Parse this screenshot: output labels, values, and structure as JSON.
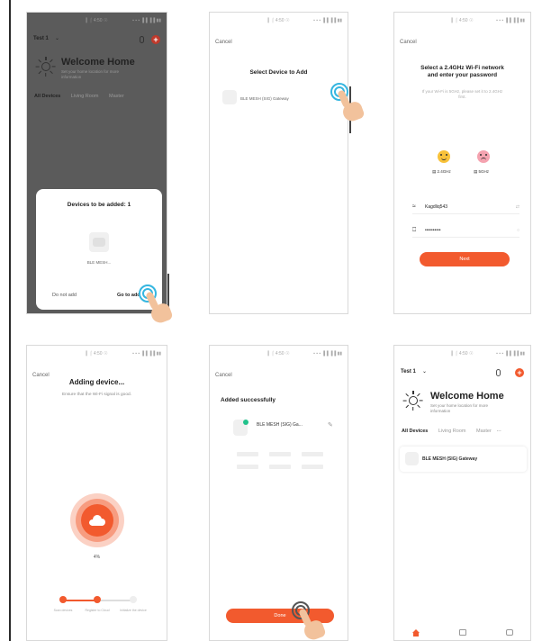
{
  "status": {
    "carrier": "▐◔ 4:58 ○",
    "center": "▎⌠ 4:50 ☉",
    "right": "▪ ▪ ▪ ▐▐ ▐▐ ▮▮"
  },
  "common": {
    "cancel": "Cancel"
  },
  "screen1": {
    "home_name": "Test 1",
    "welcome": "Welcome Home",
    "welcome_sub": "Set your home location for more information",
    "tabs": [
      "All Devices",
      "Living Room",
      "Master"
    ],
    "sheet_title": "Devices to be added: 1",
    "device_name": "BLE MESH...",
    "btn_cancel": "Do not add",
    "btn_go": "Go to add"
  },
  "screen2": {
    "title": "Select Device to Add",
    "device_item": "BLE MESH (SIG) Gateway"
  },
  "screen3": {
    "title_line1": "Select a 2.4GHz Wi-Fi network",
    "title_line2": "and enter your password",
    "subtitle": "If your Wi-Fi is 5GHz, please set it to 2.4GHz first.",
    "band_24": "2.4GHz",
    "band_5": "5GHz",
    "ssid": "Kagdliq543",
    "password": "••••••••••",
    "next": "Next"
  },
  "screen4": {
    "title": "Adding device...",
    "subtitle": "Ensure that the Wi-Fi signal is good.",
    "percent": "4%",
    "steps": [
      "Scan devices",
      "Register to Cloud",
      "Initialize the device"
    ]
  },
  "screen5": {
    "title": "Added successfully",
    "device_name": "BLE MESH (SIG) Ga...",
    "done": "Done"
  },
  "screen6": {
    "home_name": "Test 1",
    "welcome": "Welcome Home",
    "welcome_sub": "Set your home location for more information",
    "tabs": [
      "All Devices",
      "Living Room",
      "Master"
    ],
    "more": "···",
    "plus": "+",
    "device_card": "BLE MESH (SIG) Gateway"
  },
  "colors": {
    "accent": "#f25a2e",
    "tap_ring": "#35b6e0",
    "success": "#21c28b"
  },
  "icons": [
    "sun-icon",
    "plus-icon",
    "mic-icon",
    "wifi-icon",
    "lock-icon",
    "cloud-icon",
    "edit-icon",
    "home-icon",
    "scene-icon",
    "me-icon",
    "tap-hand-icon"
  ]
}
